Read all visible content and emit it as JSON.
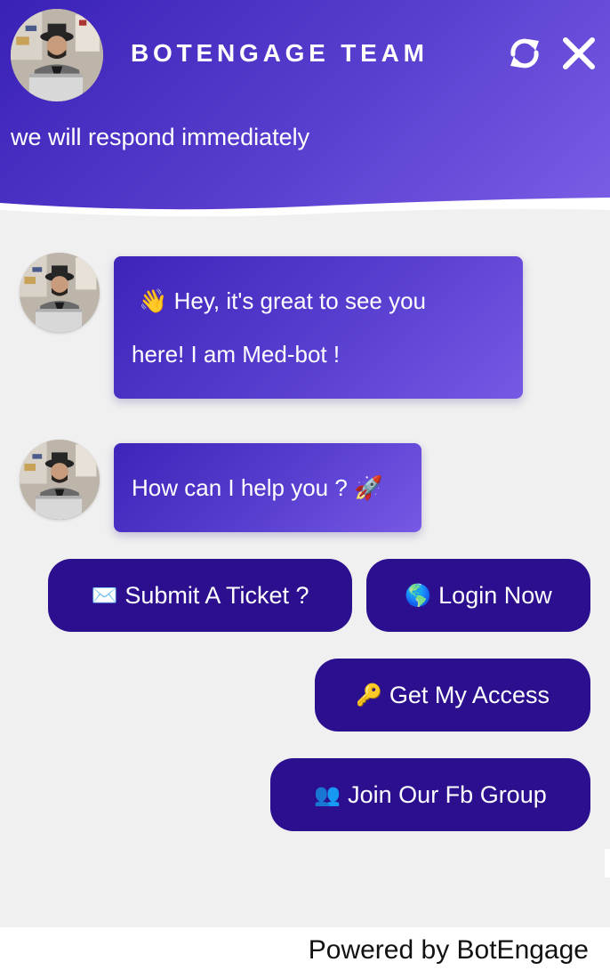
{
  "header": {
    "team_name": "BOTENGAGE TEAM",
    "tagline": "we will respond immediately",
    "refresh_icon": "refresh-icon",
    "close_icon": "close-icon"
  },
  "messages": [
    {
      "lines": [
        "Hey, it's great to see you",
        "here! I am Med-bot !"
      ],
      "lead_emoji": "👋",
      "lead_emoji_name": "waving-hand-icon"
    },
    {
      "text": "How can I help you ?",
      "trail_emoji": "🚀",
      "trail_emoji_name": "rocket-icon"
    }
  ],
  "quick_replies": [
    {
      "icon": "✉️",
      "icon_name": "envelope-icon",
      "label": "Submit A Ticket ?"
    },
    {
      "icon": "🌎",
      "icon_name": "globe-icon",
      "label": "Login Now"
    },
    {
      "icon": "🔑",
      "icon_name": "key-icon",
      "label": "Get My Access"
    },
    {
      "icon": "👥",
      "icon_name": "people-icon",
      "label": "Join Our Fb Group"
    }
  ],
  "footer": {
    "powered_by": "Powered by BotEngage"
  },
  "colors": {
    "header_gradient_start": "#3a21b6",
    "header_gradient_end": "#7b5fe6",
    "button_bg": "#2b0f8e",
    "chat_bg": "#f0f0f0"
  }
}
